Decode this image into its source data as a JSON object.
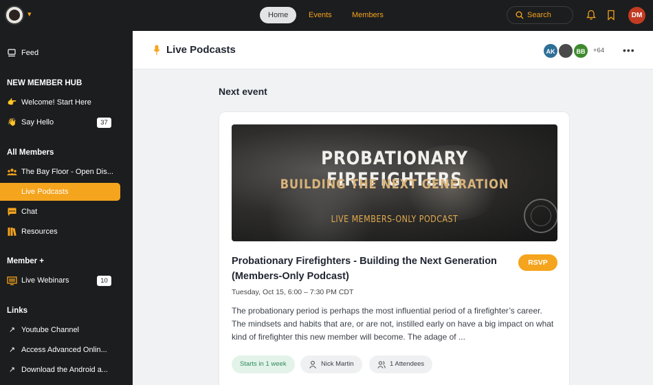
{
  "topbar": {
    "nav": [
      "Home",
      "Events",
      "Members"
    ],
    "search_label": "Search",
    "user_initials": "DM"
  },
  "sidebar": {
    "feed": "Feed",
    "section1": "NEW MEMBER HUB",
    "welcome": "Welcome! Start Here",
    "say_hello": "Say Hello",
    "say_hello_count": "37",
    "section2": "All Members",
    "bay_floor": "The Bay Floor - Open Dis...",
    "live_podcasts": "Live Podcasts",
    "chat": "Chat",
    "resources": "Resources",
    "section3": "Member +",
    "webinars": "Live Webinars",
    "webinars_count": "10",
    "section4": "Links",
    "youtube": "Youtube Channel",
    "advanced": "Access Advanced Onlin...",
    "android": "Download the Android a..."
  },
  "header": {
    "title": "Live Podcasts",
    "avatars": [
      "AK",
      "BB"
    ],
    "more_members": "+64"
  },
  "content": {
    "section_title": "Next event",
    "banner": {
      "line1": "PROBATIONARY FIREFIGHTERS",
      "line2": "BUILDING THE NEXT GENERATION",
      "line3": "LIVE MEMBERS-ONLY PODCAST"
    },
    "event_title": "Probationary Firefighters - Building the Next Generation (Members-Only Podcast)",
    "rsvp": "RSVP",
    "date": "Tuesday, Oct 15, 6:00 – 7:30 PM CDT",
    "description": "The probationary period is perhaps the most influential period of a firefighter’s career. The mindsets and habits that are, or are not, instilled early on have a big impact on what kind of firefighter this new member will become. The adage of ...",
    "starts": "Starts in 1 week",
    "host": "Nick Martin",
    "attendees": "1 Attendees"
  },
  "colors": {
    "accent": "#f5a41d",
    "dark": "#1c1d1f"
  }
}
